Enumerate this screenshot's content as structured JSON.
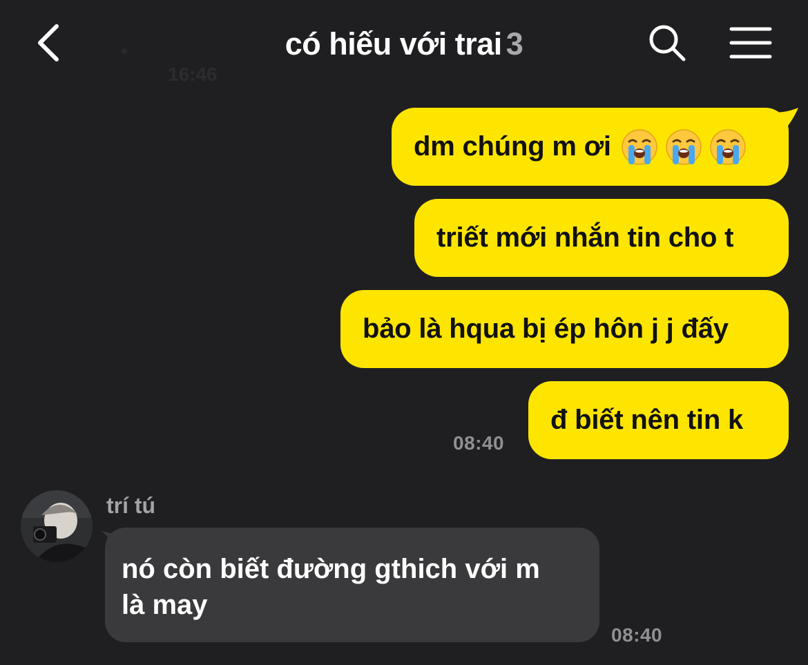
{
  "header": {
    "title": "có hiếu với trai",
    "member_count": "3",
    "back_icon": "chevron-left-icon",
    "search_icon": "search-icon",
    "menu_icon": "hamburger-menu-icon"
  },
  "faded_previous_time": "16:46",
  "outgoing": [
    {
      "text": "dm chúng m ơi",
      "emoji": [
        "😭",
        "😭",
        "😭"
      ]
    },
    {
      "text": "triết mới nhắn tin cho t"
    },
    {
      "text": "bảo là hqua bị ép hôn j j đấy"
    },
    {
      "text": "đ biết nên tin k"
    }
  ],
  "outgoing_time": "08:40",
  "incoming": {
    "sender": "trí tú",
    "lines": [
      "nó còn biết đường gthich với m",
      "là may"
    ],
    "time": "08:40"
  },
  "colors": {
    "background": "#1f1f21",
    "outgoing_bubble": "#fee500",
    "incoming_bubble": "#3a3a3c",
    "time_text": "#8f8f94"
  }
}
